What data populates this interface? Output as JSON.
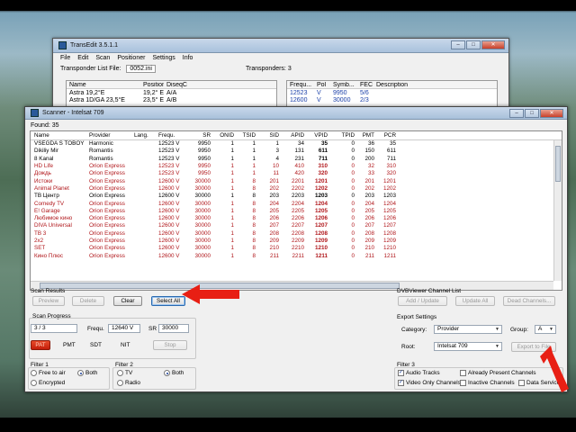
{
  "back_window": {
    "title": "TransEdit 3.5.1.1",
    "menu": [
      "File",
      "Edit",
      "Scan",
      "Positioner",
      "Settings",
      "Info"
    ],
    "transponder_list_label": "Transponder List File:",
    "transponder_list_file": "0052.ini",
    "transponders_label": "Transponders: 3",
    "sat_headers": [
      "Name",
      "Position",
      "DiseqC"
    ],
    "sat_rows": [
      [
        "Astra 19,2°E",
        "19,2° E",
        "A/A"
      ],
      [
        "Astra 1D/GA 23,5°E",
        "23,5° E",
        "A/B"
      ]
    ],
    "tp_headers": [
      "Frequ...",
      "Pol",
      "Symb...",
      "FEC",
      "Description"
    ],
    "tp_rows": [
      [
        "12523",
        "V",
        "9950",
        "5/6",
        ""
      ],
      [
        "12600",
        "V",
        "30000",
        "2/3",
        ""
      ]
    ]
  },
  "scanner": {
    "title": "Scanner - Intelsat 709",
    "found": "Found:  35",
    "headers": [
      "Name",
      "Provider",
      "Lang.",
      "Frequ.",
      "SR",
      "ONID",
      "TSID",
      "SID",
      "APID",
      "VPID",
      "TPID",
      "PMT",
      "PCR"
    ],
    "rows": [
      {
        "c": [
          "VSEGDA S TOBOY",
          "Harmonic",
          "",
          "12523 V",
          "9950",
          "1",
          "1",
          "1",
          "34",
          "35",
          "0",
          "36",
          "35"
        ],
        "red": false
      },
      {
        "c": [
          "Dikiliy Mir",
          "Romantis",
          "",
          "12523 V",
          "9950",
          "1",
          "1",
          "3",
          "131",
          "611",
          "0",
          "150",
          "611"
        ],
        "red": false
      },
      {
        "c": [
          "8 Kanal",
          "Romantis",
          "",
          "12523 V",
          "9950",
          "1",
          "1",
          "4",
          "231",
          "711",
          "0",
          "200",
          "711"
        ],
        "red": false
      },
      {
        "c": [
          "HD Life",
          "Orion Express",
          "",
          "12523 V",
          "9950",
          "1",
          "1",
          "10",
          "410",
          "310",
          "0",
          "32",
          "310"
        ],
        "red": true
      },
      {
        "c": [
          "Дождь",
          "Orion Express",
          "",
          "12523 V",
          "9950",
          "1",
          "1",
          "11",
          "420",
          "320",
          "0",
          "33",
          "320"
        ],
        "red": true
      },
      {
        "c": [
          "Истоки",
          "Orion Express",
          "",
          "12600 V",
          "30000",
          "1",
          "8",
          "201",
          "2201",
          "1201",
          "0",
          "201",
          "1201"
        ],
        "red": true
      },
      {
        "c": [
          "Animal Planet",
          "Orion Express",
          "",
          "12600 V",
          "30000",
          "1",
          "8",
          "202",
          "2202",
          "1202",
          "0",
          "202",
          "1202"
        ],
        "red": true
      },
      {
        "c": [
          "ТВ Центр",
          "Orion Express",
          "",
          "12600 V",
          "30000",
          "1",
          "8",
          "203",
          "2203",
          "1203",
          "0",
          "203",
          "1203"
        ],
        "red": false
      },
      {
        "c": [
          "Comedy TV",
          "Orion Express",
          "",
          "12600 V",
          "30000",
          "1",
          "8",
          "204",
          "2204",
          "1204",
          "0",
          "204",
          "1204"
        ],
        "red": true
      },
      {
        "c": [
          "E! Garage",
          "Orion Express",
          "",
          "12600 V",
          "30000",
          "1",
          "8",
          "205",
          "2205",
          "1205",
          "0",
          "205",
          "1205"
        ],
        "red": true
      },
      {
        "c": [
          "Любимое кино",
          "Orion Express",
          "",
          "12600 V",
          "30000",
          "1",
          "8",
          "206",
          "2206",
          "1206",
          "0",
          "206",
          "1206"
        ],
        "red": true
      },
      {
        "c": [
          "DIVA Universal",
          "Orion Express",
          "",
          "12600 V",
          "30000",
          "1",
          "8",
          "207",
          "2207",
          "1207",
          "0",
          "207",
          "1207"
        ],
        "red": true
      },
      {
        "c": [
          "ТВ 3",
          "Orion Express",
          "",
          "12600 V",
          "30000",
          "1",
          "8",
          "208",
          "2208",
          "1208",
          "0",
          "208",
          "1208"
        ],
        "red": true
      },
      {
        "c": [
          "2x2",
          "Orion Express",
          "",
          "12600 V",
          "30000",
          "1",
          "8",
          "209",
          "2209",
          "1209",
          "0",
          "209",
          "1209"
        ],
        "red": true
      },
      {
        "c": [
          "SET",
          "Orion Express",
          "",
          "12600 V",
          "30000",
          "1",
          "8",
          "210",
          "2210",
          "1210",
          "0",
          "210",
          "1210"
        ],
        "red": true
      },
      {
        "c": [
          "Кино Плюс",
          "Orion Express",
          "",
          "12600 V",
          "30000",
          "1",
          "8",
          "211",
          "2211",
          "1211",
          "0",
          "211",
          "1211"
        ],
        "red": true
      }
    ],
    "scan_results": {
      "title": "Scan Results",
      "preview": "Preview",
      "delete": "Delete",
      "clear": "Clear",
      "select_all": "Select All"
    },
    "scan_progress": {
      "title": "Scan Progress",
      "progress_value": "3 / 3",
      "frequ_label": "Frequ.",
      "frequ_value": "12640 V",
      "sr_label": "SR",
      "sr_value": "30000",
      "pat": "PAT",
      "pmt": "PMT",
      "sdt": "SDT",
      "nit": "NIT",
      "stop": "Stop"
    },
    "filter1": {
      "title": "Filter 1",
      "opt1": "Free to air",
      "opt2": "Both",
      "opt3": "Encrypted"
    },
    "filter2": {
      "title": "Filter 2",
      "opt1": "TV",
      "opt2": "Both",
      "opt3": "Radio"
    },
    "dvbviewer": {
      "title": "DVBViewer Channel List",
      "add_update": "Add / Update",
      "update_all": "Update All",
      "dead_channels": "Dead Channels..."
    },
    "export": {
      "title": "Export Settings",
      "category_label": "Category:",
      "category_value": "Provider",
      "group_label": "Group:",
      "group_value": "A",
      "root_label": "Root:",
      "root_value": "Intelsat 709",
      "export_button": "Export to File"
    },
    "filter3": {
      "title": "Filter 3",
      "audio_tracks": "Audio Tracks",
      "already_present": "Already Present Channels",
      "video_only": "Video Only Channels",
      "inactive": "Inactive Channels",
      "data_services": "Data Services"
    }
  },
  "colors": {
    "accent_red": "#b0161a",
    "arrow_red": "#e81f14",
    "pat_red": "#d6301c"
  }
}
